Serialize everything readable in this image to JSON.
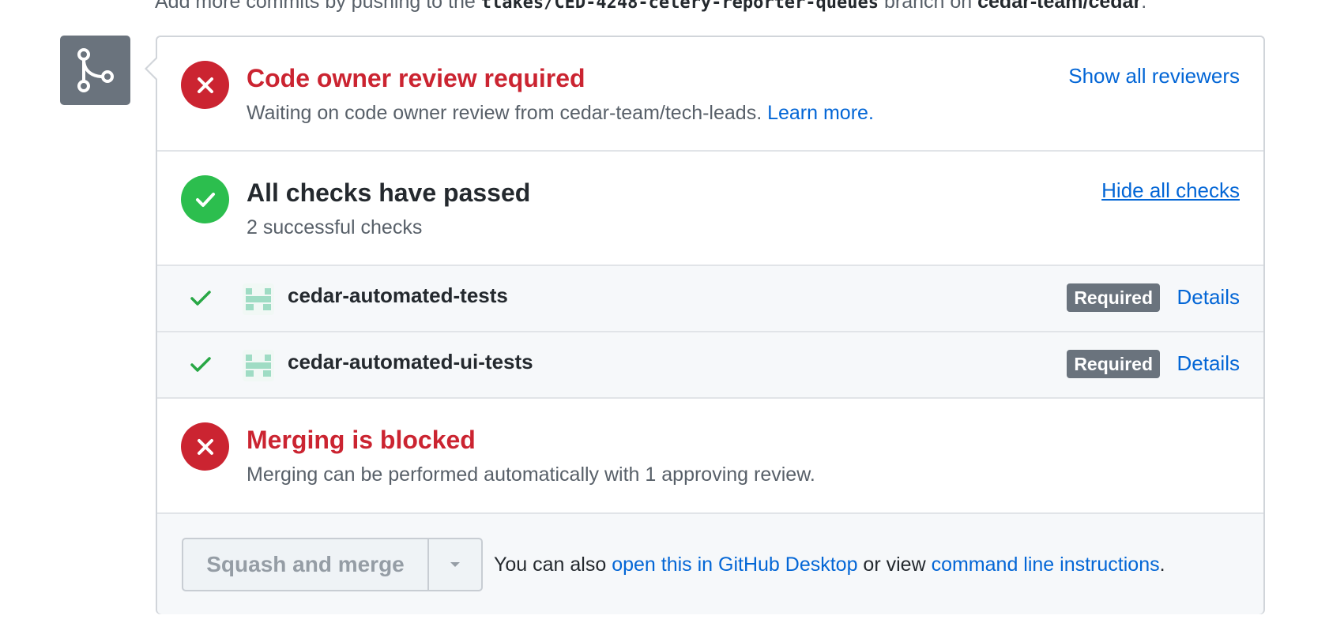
{
  "top_hint": {
    "prefix": "Add more commits by pushing to the ",
    "branch": "tlakes/CED-4248-celery-reporter-queues",
    "middle": " branch on ",
    "repo": "cedar-team/cedar",
    "suffix": "."
  },
  "icons": {
    "merge": "git-merge-icon",
    "fail": "x-icon",
    "pass": "check-icon",
    "app": "app-avatar-icon",
    "caret": "caret-down-icon"
  },
  "colors": {
    "red": "#cb2431",
    "green": "#2cbe4e",
    "link": "#0366d6",
    "badge": "#6a737d"
  },
  "review": {
    "title": "Code owner review required",
    "desc_prefix": "Waiting on code owner review from cedar-team/tech-leads. ",
    "learn_more": "Learn more.",
    "action": "Show all reviewers"
  },
  "checks": {
    "title": "All checks have passed",
    "desc": "2 successful checks",
    "action": "Hide all checks",
    "items": [
      {
        "name": "cedar-automated-tests",
        "badge": "Required",
        "details": "Details"
      },
      {
        "name": "cedar-automated-ui-tests",
        "badge": "Required",
        "details": "Details"
      }
    ]
  },
  "blocked": {
    "title": "Merging is blocked",
    "desc": "Merging can be performed automatically with 1 approving review."
  },
  "merge": {
    "button": "Squash and merge",
    "help_prefix": "You can also ",
    "desktop_link": "open this in GitHub Desktop",
    "help_middle": " or view ",
    "cli_link": "command line instructions",
    "help_suffix": "."
  }
}
